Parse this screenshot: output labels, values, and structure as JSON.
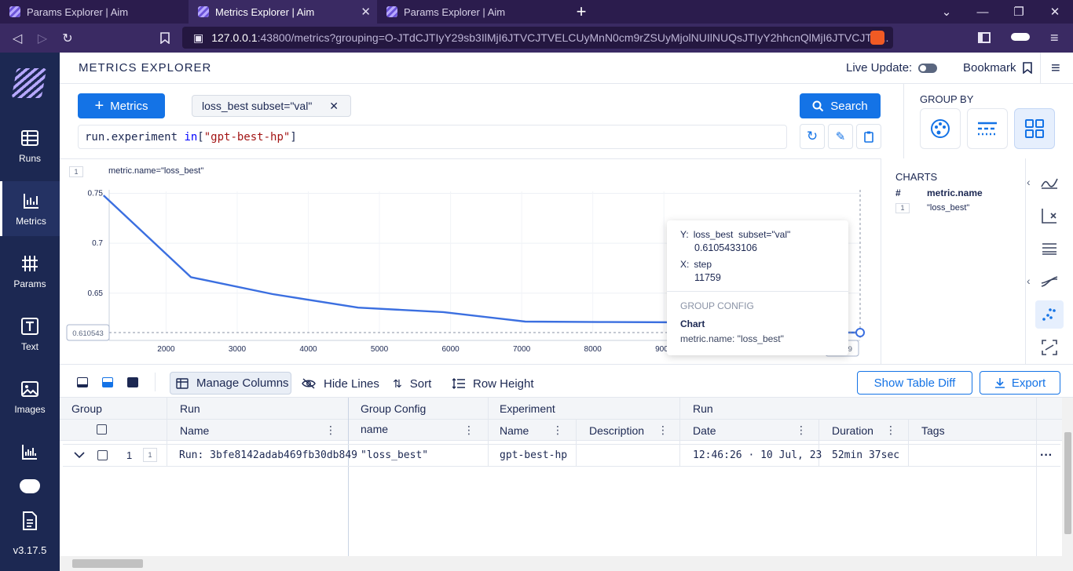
{
  "browser": {
    "tabs": [
      {
        "title": "Params Explorer | Aim",
        "active": false
      },
      {
        "title": "Metrics Explorer | Aim",
        "active": true
      },
      {
        "title": "Params Explorer | Aim",
        "active": false
      }
    ],
    "url_host": "127.0.0.1",
    "url_rest": ":43800/metrics?grouping=O-JTdCJTIyY29sb3IlMjI6JTVCJTVELCUyMnN0cm9rZSUyMjolNUIlNUQsJTIyY2hhcnQlMjI6JTVCJTIy..."
  },
  "sidebar": {
    "items": [
      {
        "label": "Runs",
        "icon": "table-icon"
      },
      {
        "label": "Metrics",
        "icon": "chart-icon"
      },
      {
        "label": "Params",
        "icon": "hash-grid-icon"
      },
      {
        "label": "Text",
        "icon": "text-icon"
      },
      {
        "label": "Images",
        "icon": "image-icon"
      }
    ],
    "version": "v3.17.5"
  },
  "header": {
    "title": "METRICS EXPLORER",
    "live_update": "Live Update:",
    "bookmark": "Bookmark"
  },
  "query": {
    "metrics_button": "Metrics",
    "chip": "loss_best subset=\"val\"",
    "expr_a": "run.experiment ",
    "expr_kw": "in",
    "expr_b": "[",
    "expr_str": "\"gpt-best-hp\"",
    "expr_c": "]",
    "search_button": "Search"
  },
  "group_by": {
    "label": "GROUP BY"
  },
  "chart": {
    "panel_index": "1",
    "label": "metric.name=\"loss_best\"",
    "hover_y_label": "0.610543",
    "hover_x_label": "11759"
  },
  "chart_data": {
    "type": "line",
    "x": [
      0,
      2350,
      3500,
      4700,
      5900,
      7050,
      8200,
      9400,
      10600,
      11759
    ],
    "y": [
      0.748,
      0.666,
      0.649,
      0.6355,
      0.631,
      0.6215,
      0.621,
      0.6207,
      0.6106,
      0.6105
    ],
    "xlim": [
      1200,
      11759
    ],
    "ylim": [
      0.6105,
      0.752
    ],
    "xticks": [
      "2000",
      "3000",
      "4000",
      "5000",
      "6000",
      "7000",
      "8000",
      "9000"
    ],
    "yticks": [
      "0.75",
      "0.7",
      "0.65"
    ],
    "series_color": "#3b6fe0"
  },
  "tooltip": {
    "y_prefix": "Y:",
    "y_metric": "loss_best  subset=\"val\"",
    "y_value": "0.6105433106",
    "x_prefix": "X:",
    "x_metric": "step",
    "x_value": "11759",
    "group_config_title": "GROUP CONFIG",
    "chart_label": "Chart",
    "chart_value": "metric.name: \"loss_best\""
  },
  "charts_panel": {
    "title": "CHARTS",
    "col_hash": "#",
    "col_name": "metric.name",
    "rows": [
      {
        "index": "1",
        "name": "\"loss_best\""
      }
    ]
  },
  "table_toolbar": {
    "manage_columns": "Manage Columns",
    "hide_lines": "Hide Lines",
    "sort": "Sort",
    "row_height": "Row Height",
    "show_table_diff": "Show Table Diff",
    "export": "Export"
  },
  "table": {
    "group_headers": [
      "Group",
      "Run",
      "Group Config",
      "Experiment",
      "Run"
    ],
    "columns": [
      "Name",
      "name",
      "Name",
      "Description",
      "Date",
      "Duration",
      "Tags"
    ],
    "row": {
      "index": "1",
      "chart_index": "1",
      "run_name": "Run: 3bfe8142adab469fb30db849",
      "group_config_name": "\"loss_best\"",
      "experiment": "gpt-best-hp",
      "description": "",
      "date": "12:46:26 · 10 Jul, 23",
      "duration": "52min 37sec",
      "tags": ""
    }
  }
}
